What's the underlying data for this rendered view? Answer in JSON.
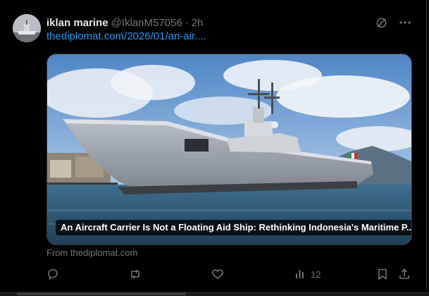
{
  "tweet": {
    "display_name": "iklan marine",
    "handle": "@IklanM57056",
    "separator": "·",
    "time": "2h",
    "link_text": "thediplomat.com/2026/01/an-air....",
    "avatar_icon": "ship-avatar-icon",
    "header_icons": [
      "grok-icon",
      "more-icon"
    ]
  },
  "card": {
    "image_icon": "aircraft-carrier-photo",
    "caption": "An Aircraft Carrier Is Not a Floating Aid Ship: Rethinking Indonesia's Maritime P...",
    "source": "From thediplomat.com"
  },
  "actions": {
    "reply_count": "",
    "repost_count": "",
    "like_count": "",
    "views_count": "12",
    "icons": [
      "reply-icon",
      "repost-icon",
      "like-icon",
      "views-icon",
      "bookmark-icon",
      "share-icon"
    ]
  },
  "colors": {
    "background": "#000000",
    "primary_text": "#e7e9ea",
    "secondary_text": "#71767b",
    "link": "#1d9bf0"
  }
}
